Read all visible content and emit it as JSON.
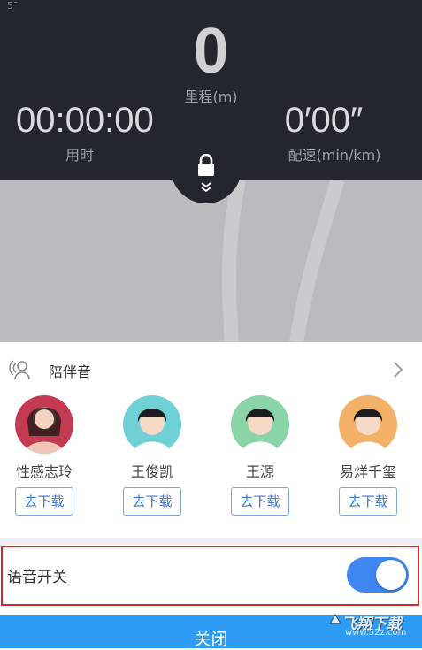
{
  "status_glyph": "5ˉ",
  "stats": {
    "distance_value": "0",
    "distance_label": "里程(m)",
    "time_value": "00:00:00",
    "time_label": "用时",
    "pace_value": "0′00″",
    "pace_label": "配速(min/km)"
  },
  "icons": {
    "lock": "lock-icon",
    "chevrons": "double-chevron-down-icon",
    "companion": "headphones-person-icon",
    "chevron_right": "chevron-right-icon"
  },
  "companion": {
    "title": "陪伴音",
    "voices": [
      {
        "name": "性感志玲",
        "download_label": "去下载",
        "avatar_bg": "#c33b52"
      },
      {
        "name": "王俊凯",
        "download_label": "去下载",
        "avatar_bg": "#6fd0d6"
      },
      {
        "name": "王源",
        "download_label": "去下载",
        "avatar_bg": "#8bd4a7"
      },
      {
        "name": "易烊千玺",
        "download_label": "去下载",
        "avatar_bg": "#f3b067"
      }
    ]
  },
  "voice_switch": {
    "label": "语音开关",
    "on": true
  },
  "close_label": "关闭",
  "watermark": {
    "title": "飞翔下载",
    "url": "www.52z.com"
  },
  "colors": {
    "header_bg": "#24262e",
    "accent": "#3f86f0",
    "close_bar": "#2e9cf5",
    "highlight": "#d8242c"
  }
}
